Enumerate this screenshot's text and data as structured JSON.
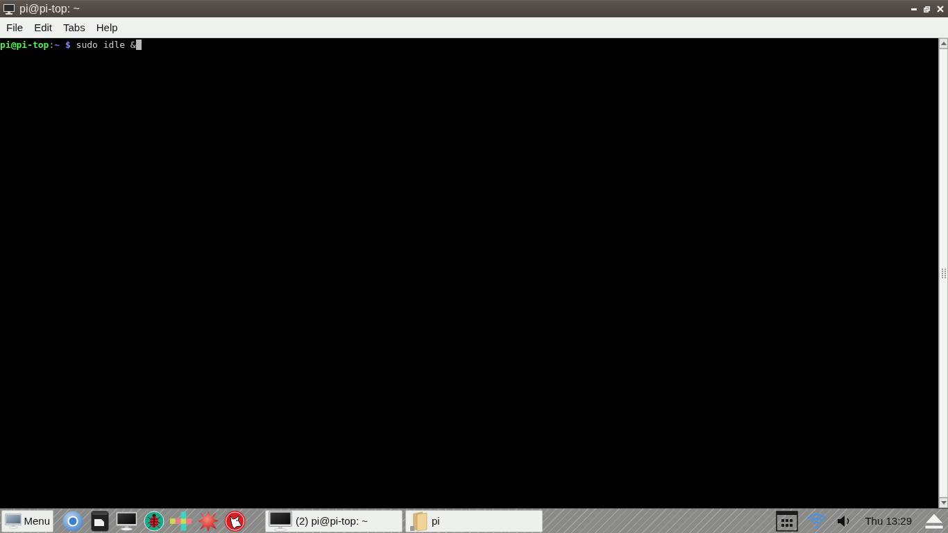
{
  "window": {
    "title": "pi@pi-top: ~"
  },
  "menu_bar": {
    "items": [
      "File",
      "Edit",
      "Tabs",
      "Help"
    ]
  },
  "terminal": {
    "lines": [
      {
        "user_host": "pi@pi-top",
        "separator": ":",
        "path": "~",
        "symbol": "$",
        "command": "sudo idle &"
      }
    ]
  },
  "taskbar": {
    "menu_button": "Menu",
    "windows": [
      {
        "kind": "terminal",
        "label": "(2) pi@pi-top: ~"
      },
      {
        "kind": "folder",
        "label": "pi"
      }
    ],
    "clock": "Thu 13:29"
  }
}
